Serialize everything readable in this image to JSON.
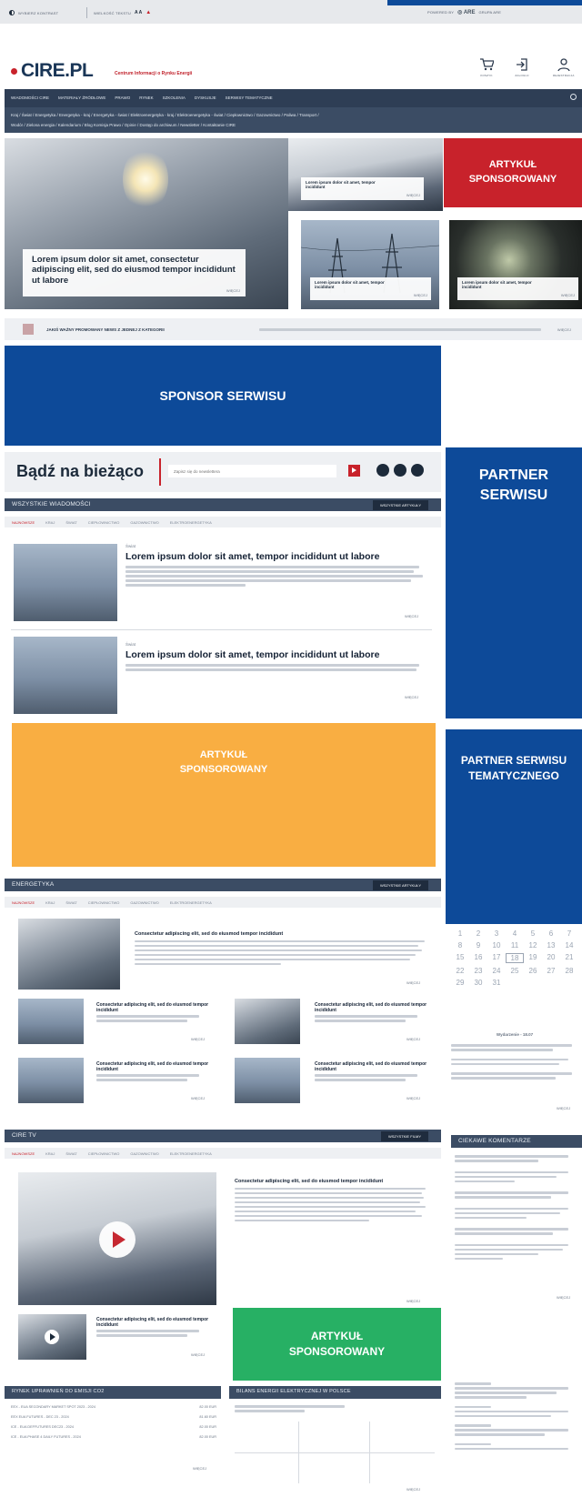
{
  "topbar": {
    "lang": "WYBIERZ KONTRAST",
    "view": "WIELKOŚĆ TEKSTU",
    "right1": "powered by",
    "right_brand": "ARE",
    "right2": "GRUPA ARE"
  },
  "header": {
    "logo": "CIRE.PL",
    "tagline": "Centrum Informacji o Rynku Energii",
    "icons": [
      {
        "icon": "cart-icon",
        "label": "Koszyk"
      },
      {
        "icon": "login-icon",
        "label": "Zaloguj"
      },
      {
        "icon": "user-icon",
        "label": "Rejestracja"
      }
    ]
  },
  "nav": {
    "primary": [
      "Wiadomości CIRE",
      "Materiały źródłowe",
      "Prawo",
      "Rynek",
      "Szkolenia",
      "Dyskusje",
      "Serwisy tematyczne"
    ],
    "secondary_line1": "Kraj / Świat / Energetyka / Energetyka - kraj / Energetyka - świat / Elektroenergetyka - kraj / Elektroenergetyka - świat / Ciepłownictwo / Gazownictwo / Paliwa / Transport /",
    "secondary_line2": "Wodór / Zielona energia / Kalendarium / Blog Komisja Prawo / Opinie / Dostęp do archiwum / Newsletter / Kontaktanie CIRE"
  },
  "hero": {
    "main_title": "Lorem ipsum dolor sit amet, consectetur adipiscing elit, sed do eiusmod tempor incididunt ut labore",
    "more": "więcej",
    "small1_title": "Lorem ipsum dolor sit amet, tempor incididunt",
    "small2_title": "Lorem ipsum dolor sit amet, tempor incididunt",
    "small3_title": "Lorem ipsum dolor sit amet, tempor incididunt",
    "sponsored": "ARTYKUŁ SPONSOROWANY"
  },
  "ticker": {
    "label": "JAKIŚ WAŻNY PROMOWANY NEWS Z JEDNEJ Z KATEGORII",
    "more": "więcej"
  },
  "sponsor_serwisu": "SPONSOR SERWISU",
  "partner_serwisu": "PARTNER SERWISU",
  "partner_tematyczny": "PARTNER SERWISU TEMATYCZNEGO",
  "newsletter": {
    "title": "Bądź na bieżąco",
    "placeholder": "Zapisz się do newslettera"
  },
  "news": {
    "section": "WSZYSTKIE WIADOMOŚCI",
    "btn": "wszystkie artykuły",
    "tabs": [
      "Najnowsze",
      "Kraj",
      "Świat",
      "Ciepłownictwo",
      "Gazownictwo",
      "Elektroenergetyka"
    ],
    "articles": [
      {
        "cat": "Świat",
        "title": "Lorem ipsum dolor sit amet, tempor incididunt ut labore",
        "more": "więcej"
      },
      {
        "cat": "Świat",
        "title": "Lorem ipsum dolor sit amet, tempor incididunt ut labore",
        "more": "więcej"
      }
    ]
  },
  "sponsored_orange": "ARTYKUŁ SPONSOROWANY",
  "energetyka": {
    "section": "ENERGETYKA",
    "btn": "wszystkie artykuły",
    "tabs": [
      "Najnowsze",
      "Kraj",
      "Świat",
      "Ciepłownictwo",
      "Gazownictwo",
      "Elektroenergetyka"
    ],
    "lead_title": "Consectetur adipiscing elit, sed do eiusmod tempor incididunt",
    "items": [
      "Consectetur adipiscing elit, sed do eiusmod tempor incididunt",
      "Consectetur adipiscing elit, sed do eiusmod tempor incididunt",
      "Consectetur adipiscing elit, sed do eiusmod tempor incididunt",
      "Consectetur adipiscing elit, sed do eiusmod tempor incididunt"
    ],
    "more": "więcej"
  },
  "calendar": {
    "rows": [
      [
        "1",
        "2",
        "3",
        "4",
        "5",
        "6",
        "7"
      ],
      [
        "8",
        "9",
        "10",
        "11",
        "12",
        "13",
        "14"
      ],
      [
        "15",
        "16",
        "17",
        "18",
        "19",
        "20",
        "21"
      ],
      [
        "22",
        "23",
        "24",
        "25",
        "26",
        "27",
        "28"
      ],
      [
        "29",
        "30",
        "31",
        "",
        "",
        "",
        ""
      ]
    ],
    "event_date": "Wydarzenie - 18.07",
    "more": "więcej"
  },
  "cire_tv": {
    "section": "CIRE TV",
    "btn": "wszystkie filmy",
    "tabs": [
      "Najnowsze",
      "Kraj",
      "Świat",
      "Ciepłownictwo",
      "Gazownictwo",
      "Elektroenergetyka"
    ],
    "lead_title": "Consectetur adipiscing elit, sed do eiusmod tempor incididunt",
    "item_title": "Consectetur adipiscing elit, sed do eiusmod tempor incididunt",
    "more": "więcej"
  },
  "sponsored_green": "ARTYKUŁ SPONSOROWANY",
  "comments": {
    "title": "CIEKAWE KOMENTARZE",
    "more": "więcej"
  },
  "market": {
    "title": "RYNEK UPRAWNIEŃ DO EMISJI CO2",
    "rows": [
      {
        "name": "EEX - EUA SECONDARY MARKET SPOT 2023 - 2024",
        "val": "82.00 EUR"
      },
      {
        "name": "EEX EUA FUTURES - DEC 23 - 2024",
        "val": "81.60 EUR"
      },
      {
        "name": "ICE - EUA DEFFUTURES DEC23 - 2024",
        "val": "82.00 EUR"
      },
      {
        "name": "ICE - EUA PHASE 4 DAILY FUTURES - 2024",
        "val": "82.00 EUR"
      }
    ],
    "more": "więcej"
  },
  "bilans": {
    "title": "BILANS ENERGII ELEKTRYCZNEJ W POLSCE",
    "more": "więcej"
  },
  "colors": {
    "blue": "#0d4a99",
    "red": "#c8222b",
    "orange": "#f9ae42",
    "green": "#27b064",
    "navy": "#2e3e55"
  }
}
